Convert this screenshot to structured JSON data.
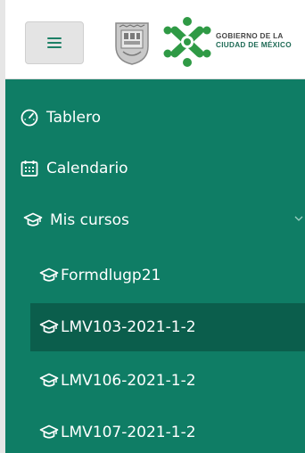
{
  "header": {
    "menu_icon": "hamburger-icon",
    "crest_icon": "cdmx-coat-of-arms-icon",
    "logo_icon": "cdmx-logo-icon",
    "gov_line1": "GOBIERNO DE LA",
    "gov_line2": "CIUDAD DE MÉXICO"
  },
  "sidebar": {
    "colors": {
      "background": "#0f7d65",
      "active": "#0b5e4c",
      "text": "#ffffff"
    },
    "items": [
      {
        "label": "Tablero",
        "icon": "gauge-icon"
      },
      {
        "label": "Calendario",
        "icon": "calendar-icon"
      },
      {
        "label": "Mis cursos",
        "icon": "graduation-cap-icon",
        "expanded": true
      },
      {
        "label": "Formdlugp21",
        "icon": "graduation-cap-icon"
      },
      {
        "label": "LMV103-2021-1-2",
        "icon": "graduation-cap-icon",
        "active": true
      },
      {
        "label": "LMV106-2021-1-2",
        "icon": "graduation-cap-icon"
      },
      {
        "label": "LMV107-2021-1-2",
        "icon": "graduation-cap-icon"
      }
    ]
  }
}
